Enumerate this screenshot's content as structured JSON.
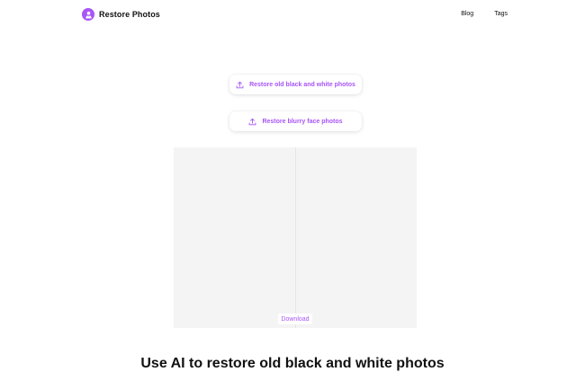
{
  "header": {
    "brand_name": "Restore Photos",
    "logo_icon": "person-bust-icon",
    "nav": [
      {
        "label": "Blog"
      },
      {
        "label": "Tags"
      }
    ]
  },
  "uploads": {
    "bw_label": "Restore old black and white photos",
    "face_label": "Restore blurry face photos",
    "icon": "upload-icon"
  },
  "compare": {
    "download_label": "Download"
  },
  "headline": "Use AI to restore old black and white photos",
  "colors": {
    "accent": "#a855f7",
    "compare_bg": "#f4f4f4"
  }
}
